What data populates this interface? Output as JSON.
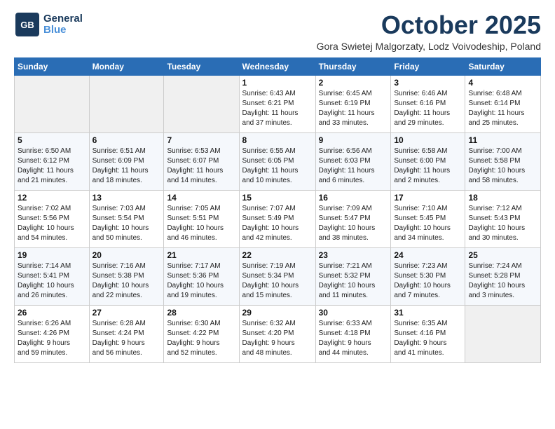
{
  "logo": {
    "line1": "General",
    "line2": "Blue"
  },
  "title": "October 2025",
  "subtitle": "Gora Swietej Malgorzaty, Lodz Voivodeship, Poland",
  "headers": [
    "Sunday",
    "Monday",
    "Tuesday",
    "Wednesday",
    "Thursday",
    "Friday",
    "Saturday"
  ],
  "weeks": [
    [
      {
        "day": "",
        "info": ""
      },
      {
        "day": "",
        "info": ""
      },
      {
        "day": "",
        "info": ""
      },
      {
        "day": "1",
        "info": "Sunrise: 6:43 AM\nSunset: 6:21 PM\nDaylight: 11 hours\nand 37 minutes."
      },
      {
        "day": "2",
        "info": "Sunrise: 6:45 AM\nSunset: 6:19 PM\nDaylight: 11 hours\nand 33 minutes."
      },
      {
        "day": "3",
        "info": "Sunrise: 6:46 AM\nSunset: 6:16 PM\nDaylight: 11 hours\nand 29 minutes."
      },
      {
        "day": "4",
        "info": "Sunrise: 6:48 AM\nSunset: 6:14 PM\nDaylight: 11 hours\nand 25 minutes."
      }
    ],
    [
      {
        "day": "5",
        "info": "Sunrise: 6:50 AM\nSunset: 6:12 PM\nDaylight: 11 hours\nand 21 minutes."
      },
      {
        "day": "6",
        "info": "Sunrise: 6:51 AM\nSunset: 6:09 PM\nDaylight: 11 hours\nand 18 minutes."
      },
      {
        "day": "7",
        "info": "Sunrise: 6:53 AM\nSunset: 6:07 PM\nDaylight: 11 hours\nand 14 minutes."
      },
      {
        "day": "8",
        "info": "Sunrise: 6:55 AM\nSunset: 6:05 PM\nDaylight: 11 hours\nand 10 minutes."
      },
      {
        "day": "9",
        "info": "Sunrise: 6:56 AM\nSunset: 6:03 PM\nDaylight: 11 hours\nand 6 minutes."
      },
      {
        "day": "10",
        "info": "Sunrise: 6:58 AM\nSunset: 6:00 PM\nDaylight: 11 hours\nand 2 minutes."
      },
      {
        "day": "11",
        "info": "Sunrise: 7:00 AM\nSunset: 5:58 PM\nDaylight: 10 hours\nand 58 minutes."
      }
    ],
    [
      {
        "day": "12",
        "info": "Sunrise: 7:02 AM\nSunset: 5:56 PM\nDaylight: 10 hours\nand 54 minutes."
      },
      {
        "day": "13",
        "info": "Sunrise: 7:03 AM\nSunset: 5:54 PM\nDaylight: 10 hours\nand 50 minutes."
      },
      {
        "day": "14",
        "info": "Sunrise: 7:05 AM\nSunset: 5:51 PM\nDaylight: 10 hours\nand 46 minutes."
      },
      {
        "day": "15",
        "info": "Sunrise: 7:07 AM\nSunset: 5:49 PM\nDaylight: 10 hours\nand 42 minutes."
      },
      {
        "day": "16",
        "info": "Sunrise: 7:09 AM\nSunset: 5:47 PM\nDaylight: 10 hours\nand 38 minutes."
      },
      {
        "day": "17",
        "info": "Sunrise: 7:10 AM\nSunset: 5:45 PM\nDaylight: 10 hours\nand 34 minutes."
      },
      {
        "day": "18",
        "info": "Sunrise: 7:12 AM\nSunset: 5:43 PM\nDaylight: 10 hours\nand 30 minutes."
      }
    ],
    [
      {
        "day": "19",
        "info": "Sunrise: 7:14 AM\nSunset: 5:41 PM\nDaylight: 10 hours\nand 26 minutes."
      },
      {
        "day": "20",
        "info": "Sunrise: 7:16 AM\nSunset: 5:38 PM\nDaylight: 10 hours\nand 22 minutes."
      },
      {
        "day": "21",
        "info": "Sunrise: 7:17 AM\nSunset: 5:36 PM\nDaylight: 10 hours\nand 19 minutes."
      },
      {
        "day": "22",
        "info": "Sunrise: 7:19 AM\nSunset: 5:34 PM\nDaylight: 10 hours\nand 15 minutes."
      },
      {
        "day": "23",
        "info": "Sunrise: 7:21 AM\nSunset: 5:32 PM\nDaylight: 10 hours\nand 11 minutes."
      },
      {
        "day": "24",
        "info": "Sunrise: 7:23 AM\nSunset: 5:30 PM\nDaylight: 10 hours\nand 7 minutes."
      },
      {
        "day": "25",
        "info": "Sunrise: 7:24 AM\nSunset: 5:28 PM\nDaylight: 10 hours\nand 3 minutes."
      }
    ],
    [
      {
        "day": "26",
        "info": "Sunrise: 6:26 AM\nSunset: 4:26 PM\nDaylight: 9 hours\nand 59 minutes."
      },
      {
        "day": "27",
        "info": "Sunrise: 6:28 AM\nSunset: 4:24 PM\nDaylight: 9 hours\nand 56 minutes."
      },
      {
        "day": "28",
        "info": "Sunrise: 6:30 AM\nSunset: 4:22 PM\nDaylight: 9 hours\nand 52 minutes."
      },
      {
        "day": "29",
        "info": "Sunrise: 6:32 AM\nSunset: 4:20 PM\nDaylight: 9 hours\nand 48 minutes."
      },
      {
        "day": "30",
        "info": "Sunrise: 6:33 AM\nSunset: 4:18 PM\nDaylight: 9 hours\nand 44 minutes."
      },
      {
        "day": "31",
        "info": "Sunrise: 6:35 AM\nSunset: 4:16 PM\nDaylight: 9 hours\nand 41 minutes."
      },
      {
        "day": "",
        "info": ""
      }
    ]
  ]
}
